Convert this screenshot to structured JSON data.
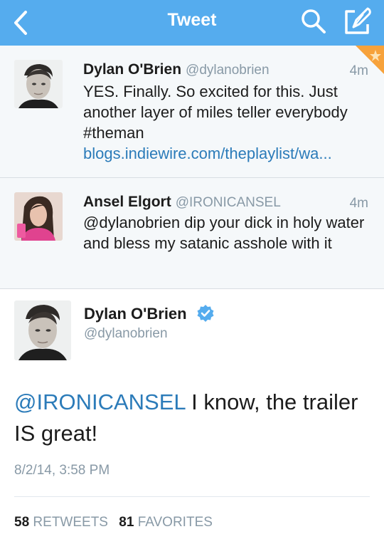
{
  "nav": {
    "title": "Tweet",
    "back_icon": "chevron-left-icon",
    "search_icon": "search-icon",
    "compose_icon": "compose-icon"
  },
  "replies": [
    {
      "name": "Dylan O'Brien",
      "handle": "@dylanobrien",
      "time": "4m",
      "text_before": "YES. Finally. So excited for this. Just another layer of miles teller everybody #theman ",
      "link": "blogs.indiewire.com/theplaylist/wa..."
    },
    {
      "name": "Ansel Elgort",
      "handle": "@IRONICANSEL",
      "time": "4m",
      "text": "@dylanobrien  dip your dick in holy water and bless my satanic asshole with it"
    }
  ],
  "main_tweet": {
    "name": "Dylan O'Brien",
    "handle": "@dylanobrien",
    "mention": "@IRONICANSEL",
    "text": " I know, the trailer IS great!",
    "date": "8/2/14, 3:58 PM",
    "retweets_count": "58",
    "retweets_label": "RETWEETS",
    "favorites_count": "81",
    "favorites_label": "FAVORITES"
  },
  "colors": {
    "nav_bg": "#55acee",
    "link": "#2b7bb9",
    "muted": "#8899a6",
    "corner": "#f7a23b"
  }
}
